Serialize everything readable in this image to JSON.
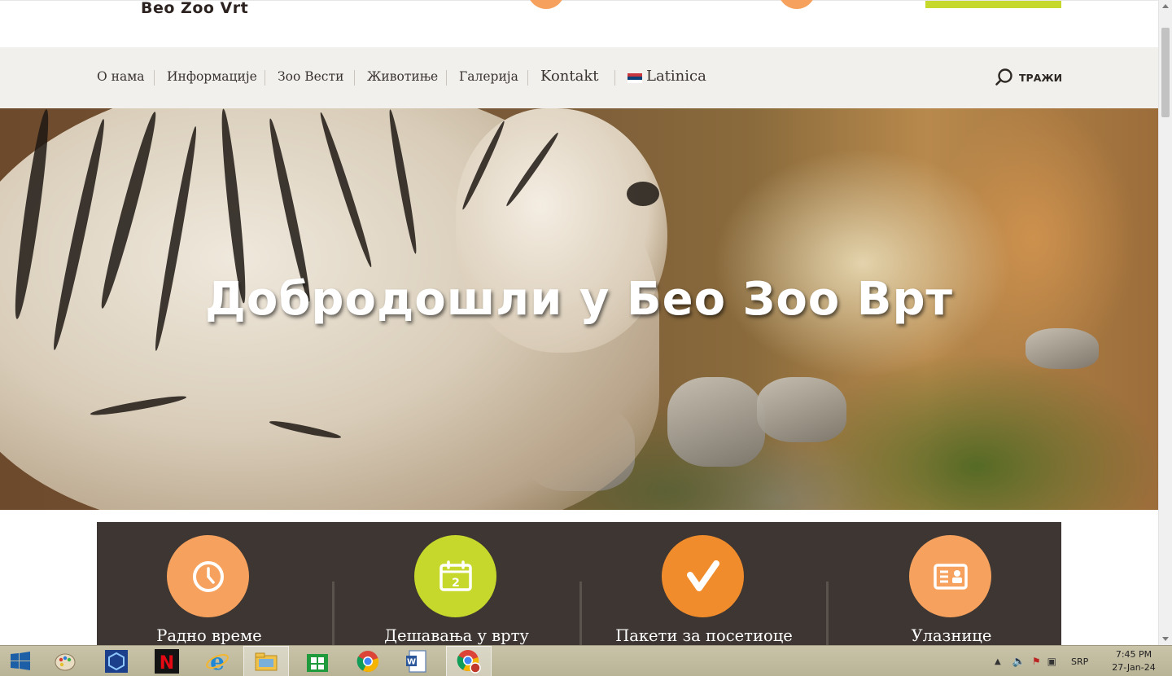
{
  "header": {
    "logo_text": "Beo Zoo Vrt"
  },
  "nav": {
    "items": [
      {
        "label": "О нама"
      },
      {
        "label": "Информације"
      },
      {
        "label": "Зоо Вести"
      },
      {
        "label": "Животиње"
      },
      {
        "label": "Галерија"
      },
      {
        "label": "Kontakt"
      },
      {
        "label": "Latinica"
      }
    ],
    "search_label": "ТРАЖИ"
  },
  "hero": {
    "title": "Добродошли у Бео Зоо Врт"
  },
  "features": [
    {
      "label": "Радно време",
      "icon": "clock-icon",
      "color": "#f6a15d"
    },
    {
      "label": "Дешавања у врту",
      "icon": "calendar-icon",
      "color": "#c5d82b"
    },
    {
      "label": "Пакети за посетиоце",
      "icon": "checkmark-icon",
      "color": "#f08c2c"
    },
    {
      "label": "Улазнице",
      "icon": "ticket-icon",
      "color": "#f6a15d"
    }
  ],
  "taskbar": {
    "language": "SRP",
    "time": "7:45 PM",
    "date": "27-Jan-24"
  },
  "colors": {
    "nav_bg": "#f1f0ec",
    "features_bg": "#3d3632",
    "accent_green": "#c5d82b",
    "accent_orange": "#f6a15d"
  }
}
